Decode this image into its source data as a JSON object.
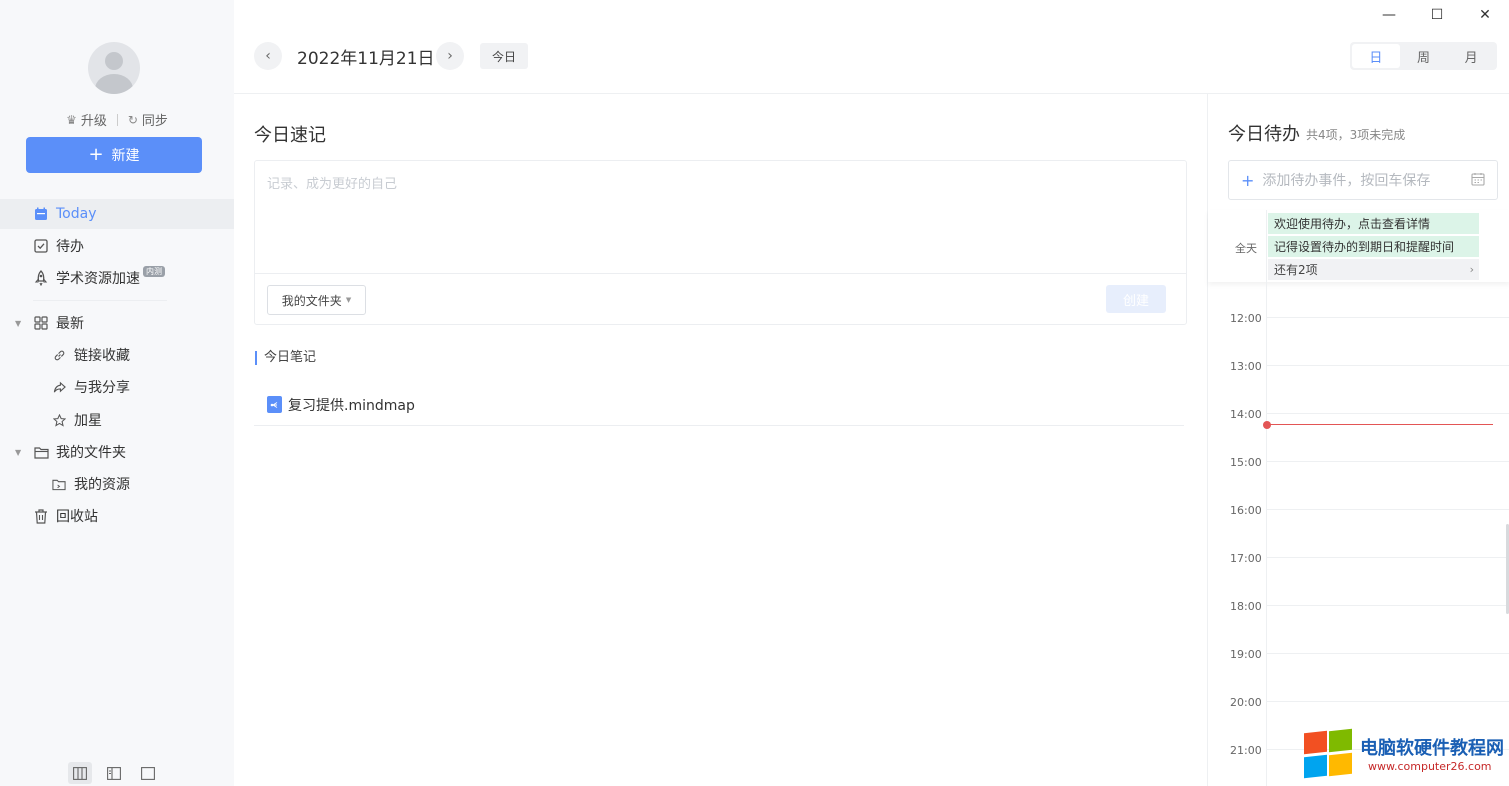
{
  "window": {
    "minimize": "—",
    "maximize": "☐",
    "close": "✕"
  },
  "sidebar": {
    "upgrade": "升级",
    "sync": "同步",
    "new_button": "新建",
    "items": {
      "today": "Today",
      "todo": "待办",
      "academic": "学术资源加速",
      "academic_badge": "内测",
      "recent": "最新",
      "links": "链接收藏",
      "shared": "与我分享",
      "starred": "加星",
      "my_folder": "我的文件夹",
      "my_resources": "我的资源",
      "trash": "回收站"
    }
  },
  "topbar": {
    "date": "2022年11月21日",
    "today_button": "今日",
    "views": [
      "日",
      "周",
      "月"
    ],
    "active_view": "日"
  },
  "quicknote": {
    "title": "今日速记",
    "placeholder": "记录、成为更好的自己",
    "folder": "我的文件夹",
    "create": "创建"
  },
  "notes": {
    "section": "今日笔记",
    "items": [
      {
        "name": "复习提供.mindmap"
      }
    ]
  },
  "todo": {
    "title": "今日待办",
    "count": "共4项，3项未完成",
    "input_placeholder": "添加待办事件，按回车保存",
    "allday_label": "全天",
    "events": [
      "欢迎使用待办，点击查看详情",
      "记得设置待办的到期日和提醒时间"
    ],
    "more": "还有2项",
    "hours": [
      "12:00",
      "13:00",
      "14:00",
      "15:00",
      "16:00",
      "17:00",
      "18:00",
      "19:00",
      "20:00",
      "21:00"
    ]
  },
  "watermark": {
    "title": "电脑软硬件教程网",
    "url": "www.computer26.com"
  },
  "colors": {
    "accent": "#5b8ff9",
    "now_line": "#e35555",
    "event_bg": "#dcf4e8"
  }
}
